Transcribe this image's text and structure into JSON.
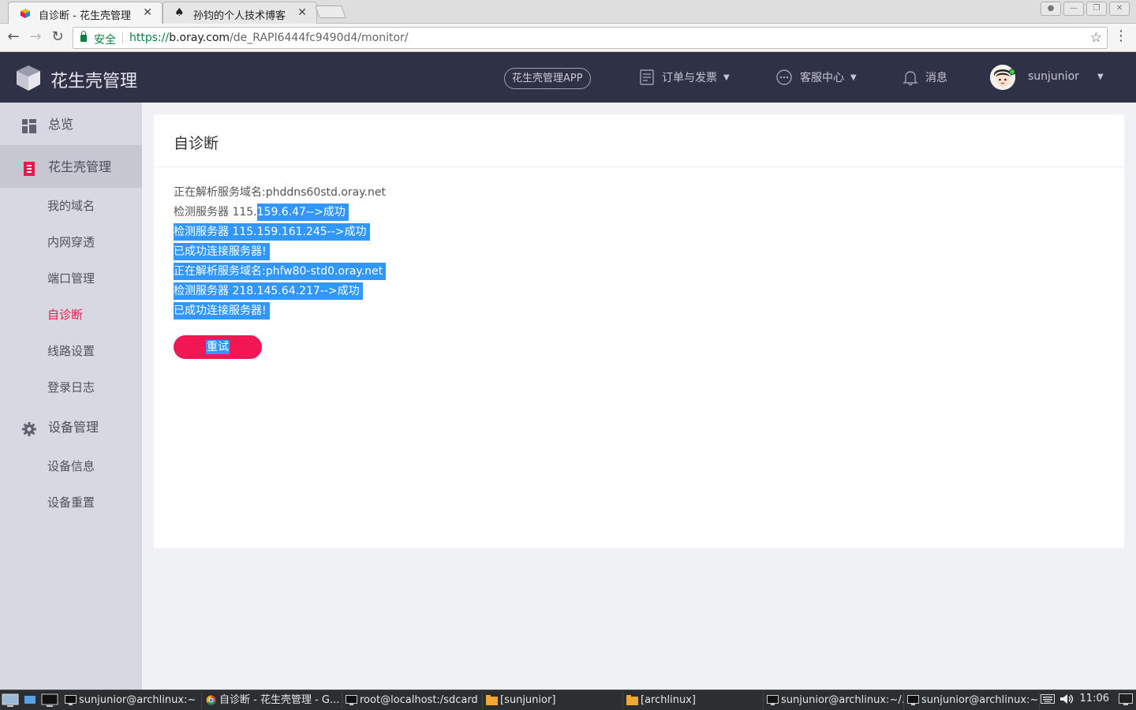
{
  "browser": {
    "tabs": [
      {
        "title": "自诊断 - 花生壳管理",
        "active": true
      },
      {
        "title": "孙钧的个人技术博客",
        "active": false
      }
    ],
    "secure_label": "安全",
    "url_scheme": "https://",
    "url_host": "b.oray.com",
    "url_path": "/de_RAPI6444fc9490d4/monitor/"
  },
  "header": {
    "logo_text": "花生壳管理",
    "app_button": "花生壳管理APP",
    "nav": {
      "orders": "订单与发票",
      "service": "客服中心",
      "messages": "消息"
    },
    "username": "sunjunior"
  },
  "sidebar": {
    "overview": "总览",
    "hsk_group": "花生壳管理",
    "hsk_items": [
      "我的域名",
      "内网穿透",
      "端口管理",
      "自诊断",
      "线路设置",
      "登录日志"
    ],
    "device_group": "设备管理",
    "device_items": [
      "设备信息",
      "设备重置"
    ],
    "active_item": "自诊断"
  },
  "main": {
    "title": "自诊断",
    "log": {
      "line1": "正在解析服务域名:phddns60std.oray.net",
      "line2_plain": "检测服务器 115.",
      "line2_sel": "159.6.47-->成功",
      "line3": "检测服务器 115.159.161.245-->成功",
      "line4": "已成功连接服务器!",
      "line5": "正在解析服务域名:phfw80-std0.oray.net",
      "line6": "检测服务器 218.145.64.217-->成功",
      "line7": "已成功连接服务器!"
    },
    "retry_button": "重试"
  },
  "taskbar": {
    "tasks": [
      "sunjunior@archlinux:~",
      "自诊断 - 花生壳管理 - G...",
      "root@localhost:/sdcard",
      "[sunjunior]",
      "[archlinux]",
      "sunjunior@archlinux:~/...",
      "sunjunior@archlinux:~"
    ],
    "clock": "11:06"
  },
  "colors": {
    "header_bg": "#2f3246",
    "sidebar_bg": "#d8d9e0",
    "accent": "#e9184c",
    "selection": "#3297fd"
  }
}
